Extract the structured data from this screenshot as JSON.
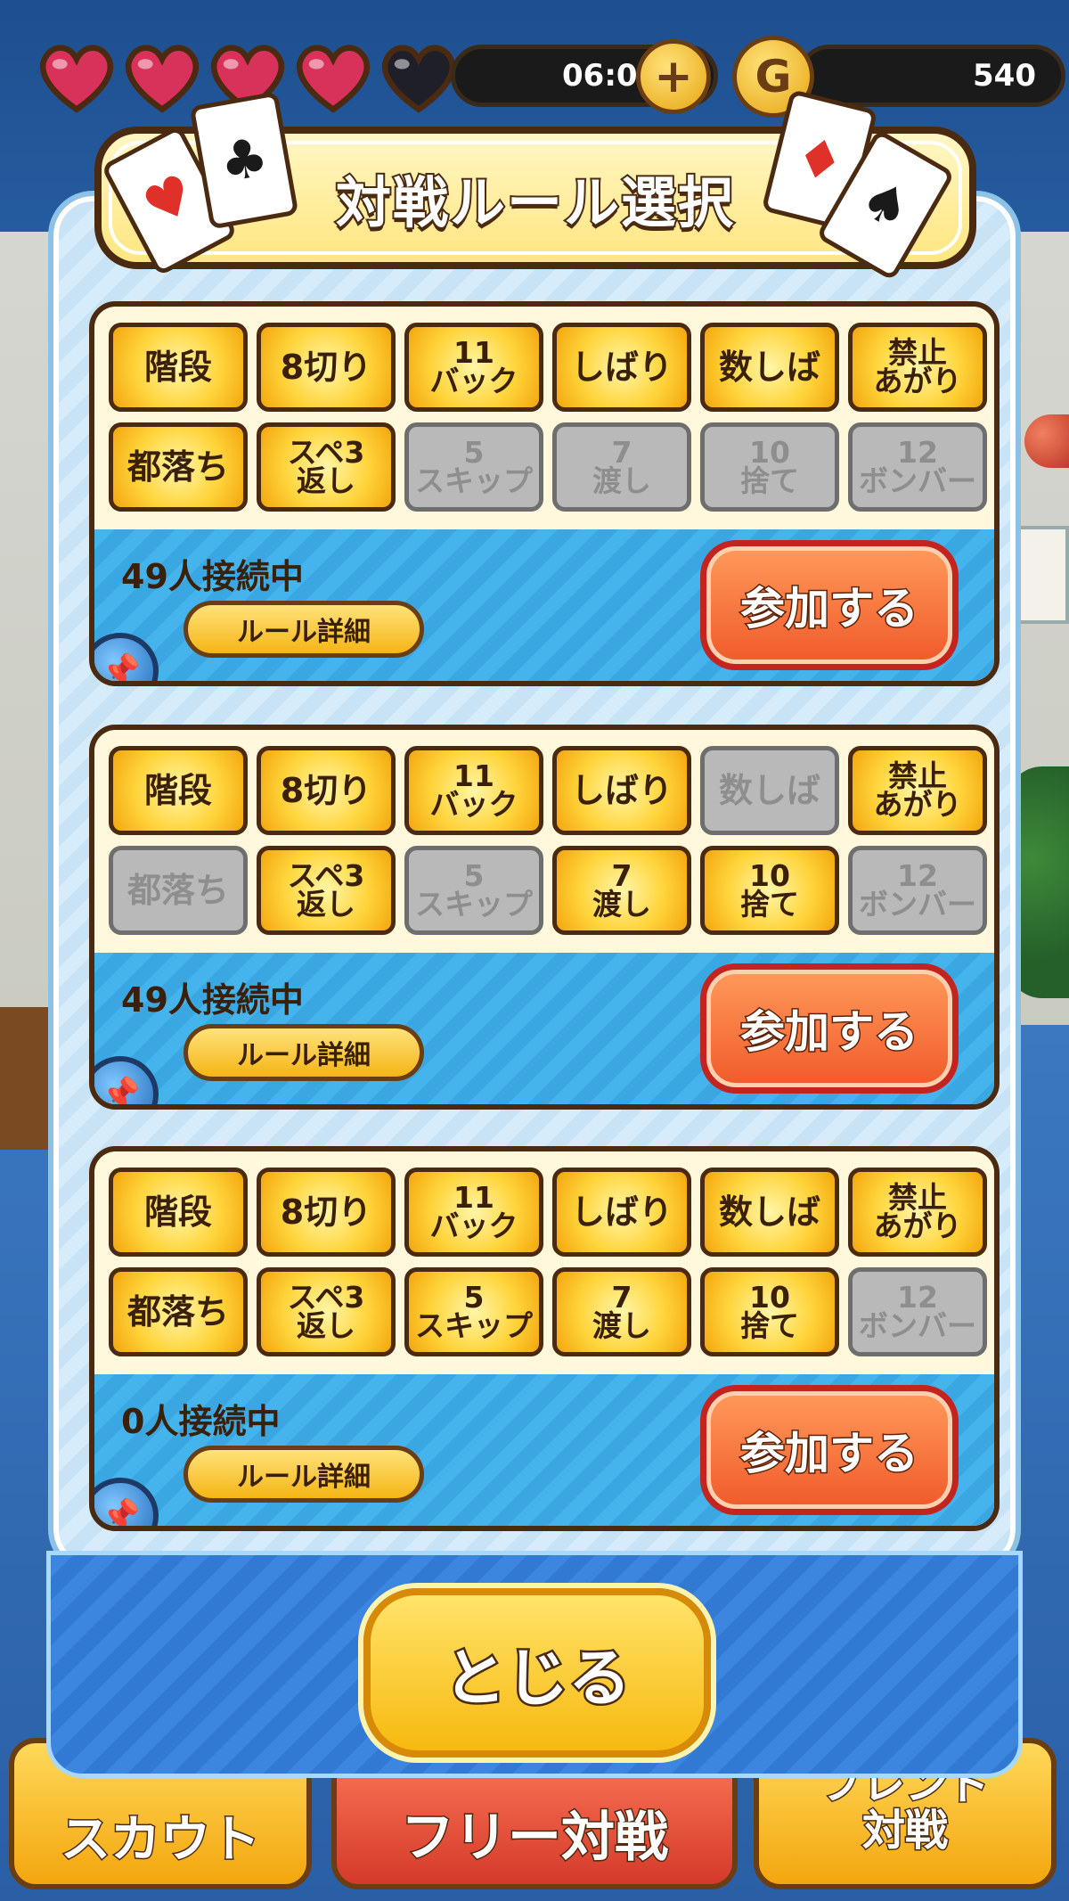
{
  "status": {
    "hearts": [
      {
        "state": "full"
      },
      {
        "state": "full"
      },
      {
        "state": "full"
      },
      {
        "state": "full"
      },
      {
        "state": "empty"
      }
    ],
    "timer": "06:05",
    "plus_icon": "plus-icon",
    "coin_icon_label": "G",
    "coins": "540"
  },
  "dialog": {
    "title": "対戦ルール選択",
    "card_suits": [
      "♥",
      "♣",
      "♦",
      "♠"
    ]
  },
  "rooms": [
    {
      "online": "49人接続中",
      "detail_label": "ルール詳細",
      "join_label": "参加する",
      "rules": [
        {
          "label": "階段",
          "on": true
        },
        {
          "label": "8切り",
          "on": true
        },
        {
          "label": "11\nバック",
          "on": true
        },
        {
          "label": "しばり",
          "on": true
        },
        {
          "label": "数しば",
          "on": true
        },
        {
          "label": "禁止\nあがり",
          "on": true
        },
        {
          "label": "都落ち",
          "on": true
        },
        {
          "label": "スペ3\n返し",
          "on": true
        },
        {
          "label": "5\nスキップ",
          "on": false
        },
        {
          "label": "7\n渡し",
          "on": false
        },
        {
          "label": "10\n捨て",
          "on": false
        },
        {
          "label": "12\nボンバー",
          "on": false
        }
      ]
    },
    {
      "online": "49人接続中",
      "detail_label": "ルール詳細",
      "join_label": "参加する",
      "rules": [
        {
          "label": "階段",
          "on": true
        },
        {
          "label": "8切り",
          "on": true
        },
        {
          "label": "11\nバック",
          "on": true
        },
        {
          "label": "しばり",
          "on": true
        },
        {
          "label": "数しば",
          "on": false
        },
        {
          "label": "禁止\nあがり",
          "on": true
        },
        {
          "label": "都落ち",
          "on": false
        },
        {
          "label": "スペ3\n返し",
          "on": true
        },
        {
          "label": "5\nスキップ",
          "on": false
        },
        {
          "label": "7\n渡し",
          "on": true
        },
        {
          "label": "10\n捨て",
          "on": true
        },
        {
          "label": "12\nボンバー",
          "on": false
        }
      ]
    },
    {
      "online": "0人接続中",
      "detail_label": "ルール詳細",
      "join_label": "参加する",
      "rules": [
        {
          "label": "階段",
          "on": true
        },
        {
          "label": "8切り",
          "on": true
        },
        {
          "label": "11\nバック",
          "on": true
        },
        {
          "label": "しばり",
          "on": true
        },
        {
          "label": "数しば",
          "on": true
        },
        {
          "label": "禁止\nあがり",
          "on": true
        },
        {
          "label": "都落ち",
          "on": true
        },
        {
          "label": "スペ3\n返し",
          "on": true
        },
        {
          "label": "5\nスキップ",
          "on": true
        },
        {
          "label": "7\n渡し",
          "on": true
        },
        {
          "label": "10\n捨て",
          "on": true
        },
        {
          "label": "12\nボンバー",
          "on": false
        }
      ]
    }
  ],
  "close_label": "とじる",
  "bottom_nav": {
    "scout": "スカウト",
    "free": "フリー対戦",
    "friend_line1": "フレンド",
    "friend_line2": "対戦"
  },
  "colors": {
    "rule_on": "#ffd43b",
    "rule_off": "#b9b9b9",
    "join_button": "#f05a2a",
    "info_band": "#45b3ec"
  }
}
